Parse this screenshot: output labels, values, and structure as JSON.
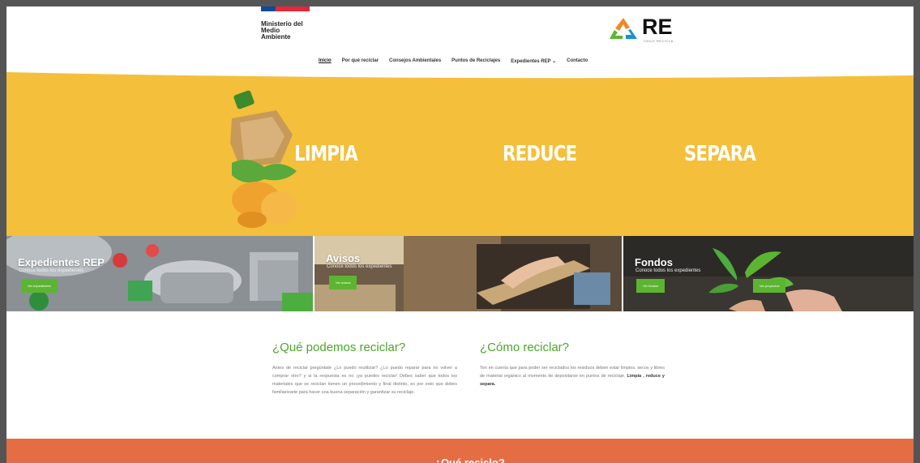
{
  "header": {
    "gov_logo_lines": [
      "Ministerio del",
      "Medio",
      "Ambiente"
    ],
    "brand": "RE",
    "brand_sub": "CHILE RECICLA"
  },
  "nav": {
    "items": [
      "Inicio",
      "Por qué reciclar",
      "Consejos Ambientales",
      "Puntos de Reciclajes",
      "Expedientes REP ⌄",
      "Contacto"
    ]
  },
  "hero": {
    "words": [
      "LIMPIA",
      "REDUCE",
      "SEPARA"
    ]
  },
  "tiles": [
    {
      "title": "Expedientes REP",
      "subtitle": "Conoce todos los expedientes",
      "buttons": [
        "Ver expedientes"
      ]
    },
    {
      "title": "Avisos",
      "subtitle": "Conoce todos los expedientes",
      "buttons": [
        "Ver avisos"
      ]
    },
    {
      "title": "Fondos",
      "subtitle": "Conoce todos los expedientes",
      "buttons": [
        "Ver fondos",
        "Ver proyectos"
      ]
    }
  ],
  "sections": {
    "left": {
      "title": "¿Qué podemos reciclar?",
      "body": "Antes de reciclar pregúntate ¿Lo puedo reutilizar? ¿Lo puedo reparar para no volver a comprar otro? y si la respuesta es no ¡ya puedes reciclar! Debes saber que todos los materiales que se reciclan tienen un procedimiento y final distinto, es por esto que debes familiarizarte para hacer una buena separación y garantizar su reciclaje."
    },
    "right": {
      "title": "¿Cómo reciclar?",
      "body_prefix": "Ten en cuenta que para poder ser reciclados los residuos deben estar limpios, secos y libres de material orgánico al momento de depositarse en puntos de reciclaje.",
      "body_bold": "Limpia , reduce y separa."
    }
  },
  "footer_band": {
    "label": "¿Qué reciclo?"
  },
  "colors": {
    "hero_yellow": "#f4bf3a",
    "accent_green": "#5cb531",
    "heading_green": "#4aa72a",
    "band_orange": "#e46d43"
  }
}
